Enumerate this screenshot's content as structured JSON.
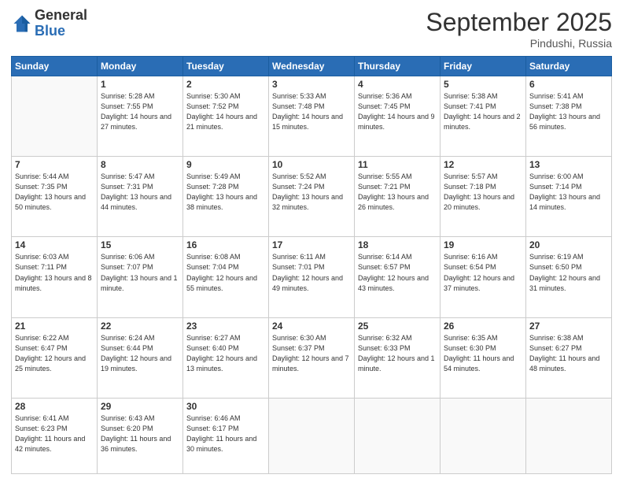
{
  "logo": {
    "general": "General",
    "blue": "Blue"
  },
  "header": {
    "month": "September 2025",
    "location": "Pindushi, Russia"
  },
  "weekdays": [
    "Sunday",
    "Monday",
    "Tuesday",
    "Wednesday",
    "Thursday",
    "Friday",
    "Saturday"
  ],
  "weeks": [
    [
      {
        "day": "",
        "info": ""
      },
      {
        "day": "1",
        "info": "Sunrise: 5:28 AM\nSunset: 7:55 PM\nDaylight: 14 hours\nand 27 minutes."
      },
      {
        "day": "2",
        "info": "Sunrise: 5:30 AM\nSunset: 7:52 PM\nDaylight: 14 hours\nand 21 minutes."
      },
      {
        "day": "3",
        "info": "Sunrise: 5:33 AM\nSunset: 7:48 PM\nDaylight: 14 hours\nand 15 minutes."
      },
      {
        "day": "4",
        "info": "Sunrise: 5:36 AM\nSunset: 7:45 PM\nDaylight: 14 hours\nand 9 minutes."
      },
      {
        "day": "5",
        "info": "Sunrise: 5:38 AM\nSunset: 7:41 PM\nDaylight: 14 hours\nand 2 minutes."
      },
      {
        "day": "6",
        "info": "Sunrise: 5:41 AM\nSunset: 7:38 PM\nDaylight: 13 hours\nand 56 minutes."
      }
    ],
    [
      {
        "day": "7",
        "info": "Sunrise: 5:44 AM\nSunset: 7:35 PM\nDaylight: 13 hours\nand 50 minutes."
      },
      {
        "day": "8",
        "info": "Sunrise: 5:47 AM\nSunset: 7:31 PM\nDaylight: 13 hours\nand 44 minutes."
      },
      {
        "day": "9",
        "info": "Sunrise: 5:49 AM\nSunset: 7:28 PM\nDaylight: 13 hours\nand 38 minutes."
      },
      {
        "day": "10",
        "info": "Sunrise: 5:52 AM\nSunset: 7:24 PM\nDaylight: 13 hours\nand 32 minutes."
      },
      {
        "day": "11",
        "info": "Sunrise: 5:55 AM\nSunset: 7:21 PM\nDaylight: 13 hours\nand 26 minutes."
      },
      {
        "day": "12",
        "info": "Sunrise: 5:57 AM\nSunset: 7:18 PM\nDaylight: 13 hours\nand 20 minutes."
      },
      {
        "day": "13",
        "info": "Sunrise: 6:00 AM\nSunset: 7:14 PM\nDaylight: 13 hours\nand 14 minutes."
      }
    ],
    [
      {
        "day": "14",
        "info": "Sunrise: 6:03 AM\nSunset: 7:11 PM\nDaylight: 13 hours\nand 8 minutes."
      },
      {
        "day": "15",
        "info": "Sunrise: 6:06 AM\nSunset: 7:07 PM\nDaylight: 13 hours\nand 1 minute."
      },
      {
        "day": "16",
        "info": "Sunrise: 6:08 AM\nSunset: 7:04 PM\nDaylight: 12 hours\nand 55 minutes."
      },
      {
        "day": "17",
        "info": "Sunrise: 6:11 AM\nSunset: 7:01 PM\nDaylight: 12 hours\nand 49 minutes."
      },
      {
        "day": "18",
        "info": "Sunrise: 6:14 AM\nSunset: 6:57 PM\nDaylight: 12 hours\nand 43 minutes."
      },
      {
        "day": "19",
        "info": "Sunrise: 6:16 AM\nSunset: 6:54 PM\nDaylight: 12 hours\nand 37 minutes."
      },
      {
        "day": "20",
        "info": "Sunrise: 6:19 AM\nSunset: 6:50 PM\nDaylight: 12 hours\nand 31 minutes."
      }
    ],
    [
      {
        "day": "21",
        "info": "Sunrise: 6:22 AM\nSunset: 6:47 PM\nDaylight: 12 hours\nand 25 minutes."
      },
      {
        "day": "22",
        "info": "Sunrise: 6:24 AM\nSunset: 6:44 PM\nDaylight: 12 hours\nand 19 minutes."
      },
      {
        "day": "23",
        "info": "Sunrise: 6:27 AM\nSunset: 6:40 PM\nDaylight: 12 hours\nand 13 minutes."
      },
      {
        "day": "24",
        "info": "Sunrise: 6:30 AM\nSunset: 6:37 PM\nDaylight: 12 hours\nand 7 minutes."
      },
      {
        "day": "25",
        "info": "Sunrise: 6:32 AM\nSunset: 6:33 PM\nDaylight: 12 hours\nand 1 minute."
      },
      {
        "day": "26",
        "info": "Sunrise: 6:35 AM\nSunset: 6:30 PM\nDaylight: 11 hours\nand 54 minutes."
      },
      {
        "day": "27",
        "info": "Sunrise: 6:38 AM\nSunset: 6:27 PM\nDaylight: 11 hours\nand 48 minutes."
      }
    ],
    [
      {
        "day": "28",
        "info": "Sunrise: 6:41 AM\nSunset: 6:23 PM\nDaylight: 11 hours\nand 42 minutes."
      },
      {
        "day": "29",
        "info": "Sunrise: 6:43 AM\nSunset: 6:20 PM\nDaylight: 11 hours\nand 36 minutes."
      },
      {
        "day": "30",
        "info": "Sunrise: 6:46 AM\nSunset: 6:17 PM\nDaylight: 11 hours\nand 30 minutes."
      },
      {
        "day": "",
        "info": ""
      },
      {
        "day": "",
        "info": ""
      },
      {
        "day": "",
        "info": ""
      },
      {
        "day": "",
        "info": ""
      }
    ]
  ]
}
